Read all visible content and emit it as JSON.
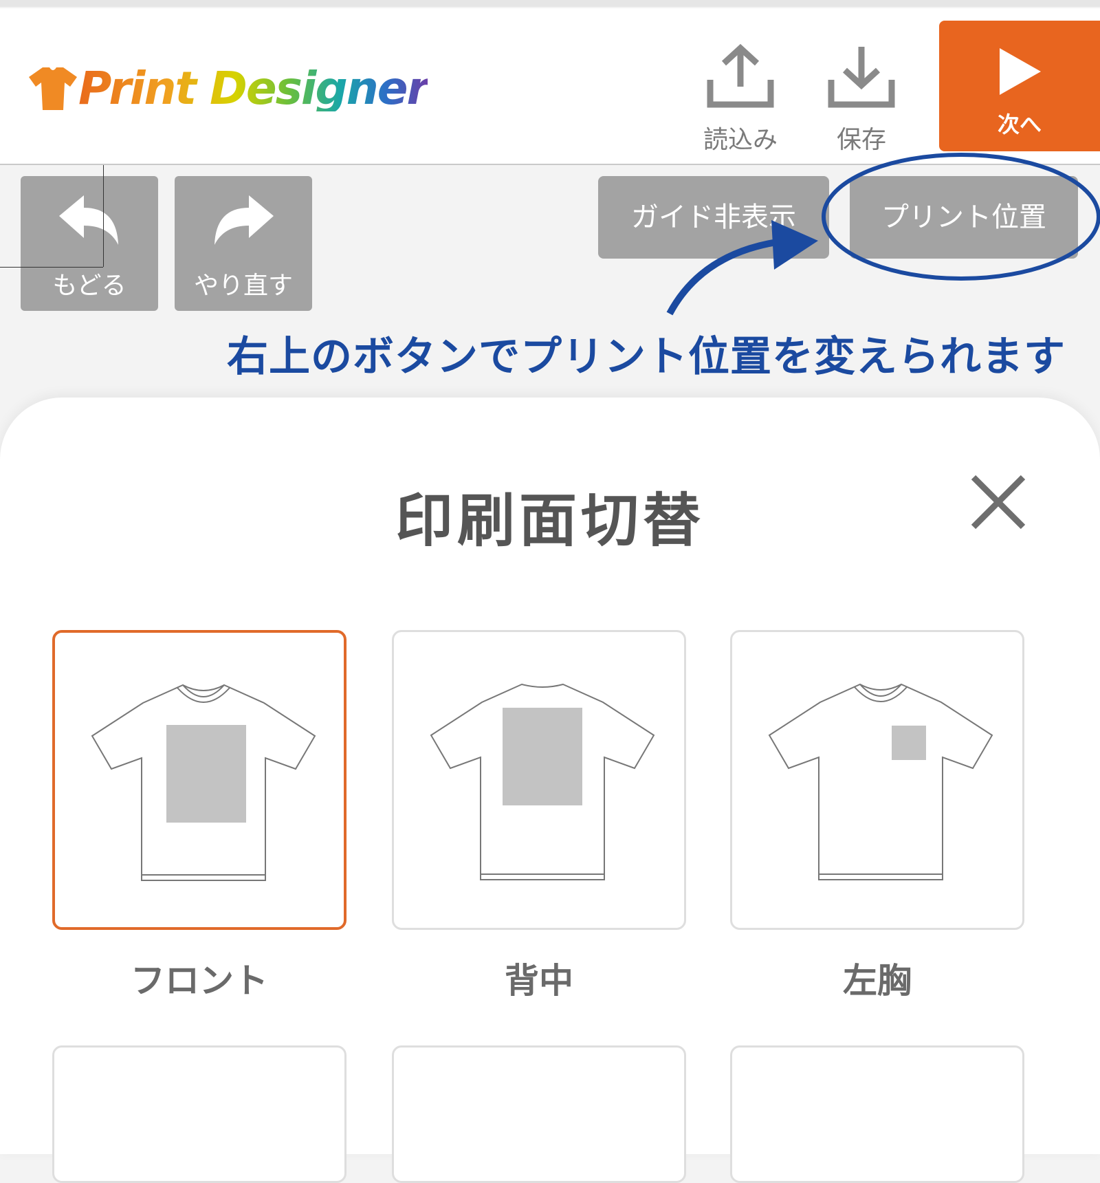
{
  "header": {
    "logo_text": "Print Designer",
    "import_label": "読込み",
    "save_label": "保存",
    "next_label": "次へ"
  },
  "toolbar": {
    "undo_label": "もどる",
    "redo_label": "やり直す",
    "guide_toggle_label": "ガイド非表示",
    "print_position_label": "プリント位置"
  },
  "annotation": {
    "text": "右上のボタンでプリント位置を変えられます"
  },
  "dialog": {
    "title": "印刷面切替",
    "options": [
      {
        "label": "フロント",
        "selected": true
      },
      {
        "label": "背中",
        "selected": false
      },
      {
        "label": "左胸",
        "selected": false
      }
    ]
  },
  "colors": {
    "accent": "#e8651f",
    "annotation": "#1b4aa0",
    "button_gray": "#a3a3a3"
  }
}
